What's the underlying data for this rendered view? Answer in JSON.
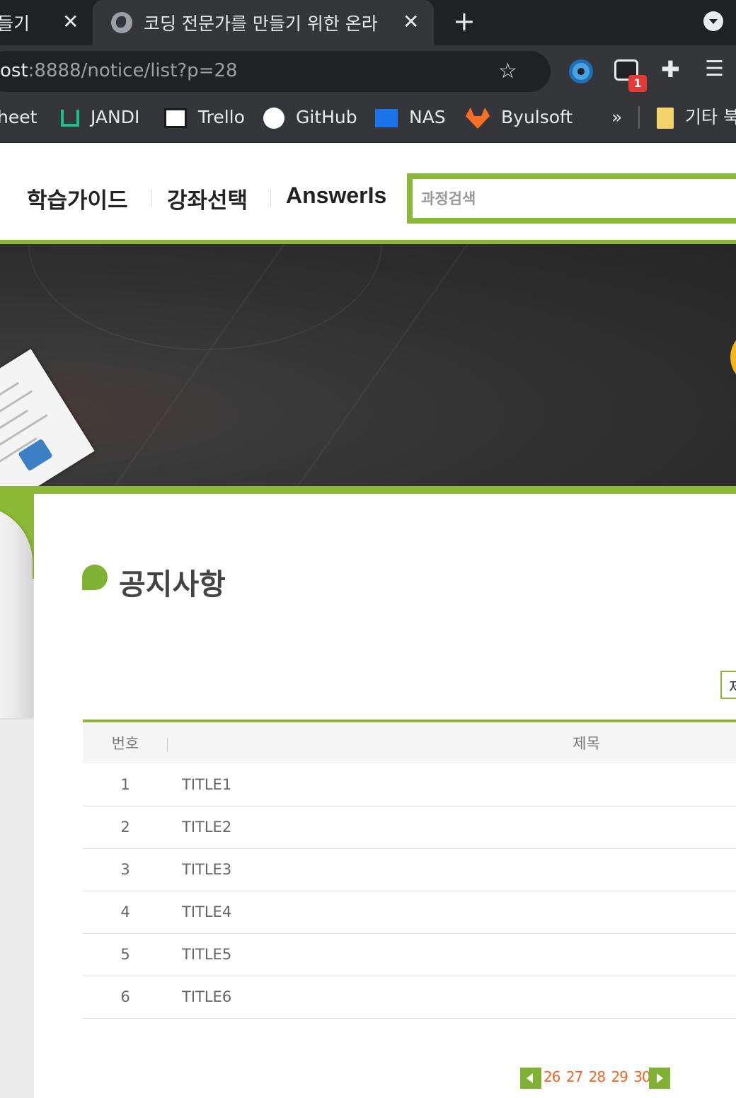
{
  "browser": {
    "tabs": [
      {
        "title": "들기",
        "active": false
      },
      {
        "title": "코딩 전문가를 만들기 위한 온라",
        "active": true
      }
    ],
    "new_tab": "+",
    "url_host": "ost",
    "url_rest": ":8888/notice/list?p=28",
    "extension_badge": "1",
    "bookmarks": [
      "heet",
      "JANDI",
      "Trello",
      "GitHub",
      "NAS",
      "Byulsoft"
    ],
    "bookmarks_more": "»",
    "other_bookmarks": "기타 북"
  },
  "header": {
    "nav": [
      "학습가이드",
      "강좌선택",
      "AnswerIs"
    ],
    "search_placeholder": "과정검색"
  },
  "page": {
    "title": "공지사항",
    "right_box_text": "제"
  },
  "board": {
    "columns": [
      "번호",
      "제목"
    ],
    "rows": [
      {
        "no": "1",
        "title": "TITLE1"
      },
      {
        "no": "2",
        "title": "TITLE2"
      },
      {
        "no": "3",
        "title": "TITLE3"
      },
      {
        "no": "4",
        "title": "TITLE4"
      },
      {
        "no": "5",
        "title": "TITLE5"
      },
      {
        "no": "6",
        "title": "TITLE6"
      }
    ]
  },
  "pagination": {
    "pages": [
      "26",
      "27",
      "28",
      "29",
      "30"
    ]
  },
  "colors": {
    "accent_green": "#8ab935",
    "page_link_orange": "#f26522"
  }
}
